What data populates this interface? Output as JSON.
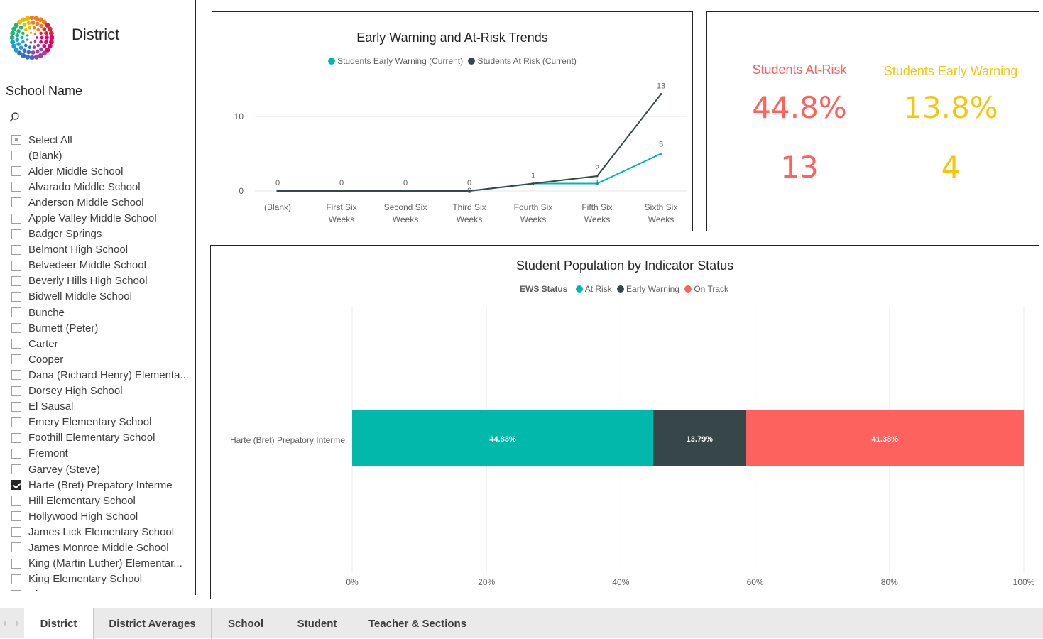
{
  "page": {
    "title": "District"
  },
  "slicer": {
    "title": "School Name",
    "items": [
      {
        "label": "Select All",
        "state": "partial"
      },
      {
        "label": "(Blank)",
        "state": "unchecked"
      },
      {
        "label": "Alder Middle School",
        "state": "unchecked"
      },
      {
        "label": "Alvarado Middle School",
        "state": "unchecked"
      },
      {
        "label": "Anderson Middle School",
        "state": "unchecked"
      },
      {
        "label": "Apple Valley Middle School",
        "state": "unchecked"
      },
      {
        "label": "Badger Springs",
        "state": "unchecked"
      },
      {
        "label": "Belmont High School",
        "state": "unchecked"
      },
      {
        "label": "Belvedeer Middle School",
        "state": "unchecked"
      },
      {
        "label": "Beverly Hills High School",
        "state": "unchecked"
      },
      {
        "label": "Bidwell Middle School",
        "state": "unchecked"
      },
      {
        "label": "Bunche",
        "state": "unchecked"
      },
      {
        "label": "Burnett (Peter)",
        "state": "unchecked"
      },
      {
        "label": "Carter",
        "state": "unchecked"
      },
      {
        "label": "Cooper",
        "state": "unchecked"
      },
      {
        "label": "Dana (Richard Henry) Elementa...",
        "state": "unchecked"
      },
      {
        "label": "Dorsey High School",
        "state": "unchecked"
      },
      {
        "label": "El Sausal",
        "state": "unchecked"
      },
      {
        "label": "Emery Elementary School",
        "state": "unchecked"
      },
      {
        "label": "Foothill Elementary School",
        "state": "unchecked"
      },
      {
        "label": "Fremont",
        "state": "unchecked"
      },
      {
        "label": "Garvey (Steve)",
        "state": "unchecked"
      },
      {
        "label": "Harte (Bret) Prepatory Interme",
        "state": "checked"
      },
      {
        "label": "Hill Elementary School",
        "state": "unchecked"
      },
      {
        "label": "Hollywood High School",
        "state": "unchecked"
      },
      {
        "label": "James Lick Elementary School",
        "state": "unchecked"
      },
      {
        "label": "James Monroe Middle School",
        "state": "unchecked"
      },
      {
        "label": "King (Martin Luther) Elementar...",
        "state": "unchecked"
      },
      {
        "label": "King Elementary School",
        "state": "unchecked"
      },
      {
        "label": "Kings Estates",
        "state": "unchecked"
      }
    ]
  },
  "kpis": {
    "at_risk": {
      "label": "Students At-Risk",
      "percent": "44.8%",
      "count": "13",
      "color": "#fd625e"
    },
    "early_warning": {
      "label": "Students Early Warning",
      "percent": "13.8%",
      "count": "4",
      "color": "#f2c80f"
    }
  },
  "tabs": [
    {
      "label": "District",
      "active": true
    },
    {
      "label": "District Averages",
      "active": false
    },
    {
      "label": "School",
      "active": false
    },
    {
      "label": "Student",
      "active": false
    },
    {
      "label": "Teacher & Sections",
      "active": false
    }
  ],
  "chart_data": [
    {
      "type": "line",
      "title": "Early Warning and At-Risk Trends",
      "categories": [
        "(Blank)",
        "First Six Weeks",
        "Second Six Weeks",
        "Third Six Weeks",
        "Fourth Six Weeks",
        "Fifth Six Weeks",
        "Sixth Six Weeks"
      ],
      "series": [
        {
          "name": "Students Early Warning (Current)",
          "color": "#01b8aa",
          "values": [
            0,
            0,
            0,
            0,
            1,
            1,
            5
          ]
        },
        {
          "name": "Students At Risk (Current)",
          "color": "#374649",
          "values": [
            0,
            0,
            0,
            0,
            1,
            2,
            13
          ]
        }
      ],
      "yticks": [
        0,
        10
      ],
      "ylim": [
        0,
        15
      ],
      "grid": true,
      "legend": "top-center"
    },
    {
      "type": "bar",
      "orientation": "horizontal",
      "stacked": "100%",
      "title": "Student Population by Indicator Status",
      "legend_title": "EWS Status",
      "categories": [
        "Harte (Bret) Prepatory Interme"
      ],
      "series": [
        {
          "name": "At Risk",
          "color": "#01b8aa",
          "values": [
            44.83
          ],
          "label": "44.83%"
        },
        {
          "name": "Early Warning",
          "color": "#374649",
          "values": [
            13.79
          ],
          "label": "13.79%"
        },
        {
          "name": "On Track",
          "color": "#fd625e",
          "values": [
            41.38
          ],
          "label": "41.38%"
        }
      ],
      "xticks": [
        "0%",
        "20%",
        "40%",
        "60%",
        "80%",
        "100%"
      ],
      "xlim": [
        0,
        100
      ],
      "grid": true,
      "legend": "top-center"
    }
  ]
}
